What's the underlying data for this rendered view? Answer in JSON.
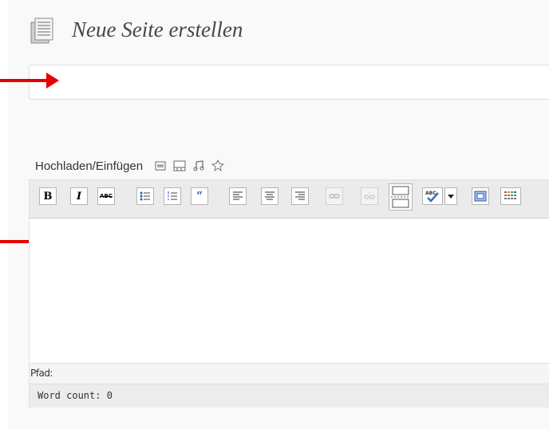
{
  "page": {
    "title": "Neue Seite erstellen"
  },
  "title_field": {
    "value": ""
  },
  "media": {
    "label": "Hochladen/Einfügen"
  },
  "toolbar": {
    "bold": "B",
    "italic": "I",
    "strikethrough": "ABC"
  },
  "editor": {
    "path_label": "Pfad:",
    "word_count": "Word count: 0"
  },
  "colors": {
    "annotation_arrow": "#e60000"
  }
}
